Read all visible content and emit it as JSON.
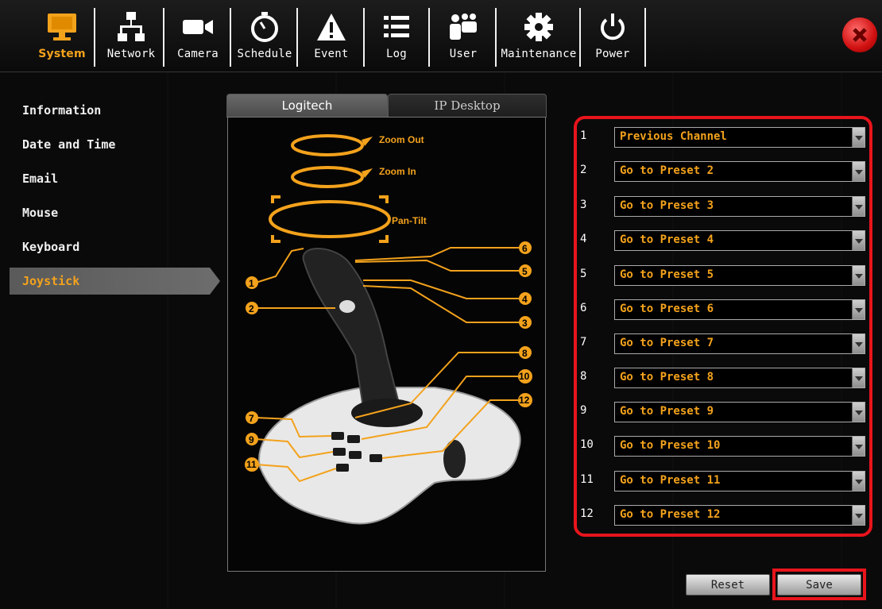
{
  "toolbar": {
    "items": [
      {
        "label": "System",
        "icon": "monitor-icon",
        "active": true
      },
      {
        "label": "Network",
        "icon": "network-icon"
      },
      {
        "label": "Camera",
        "icon": "camera-icon"
      },
      {
        "label": "Schedule",
        "icon": "stopwatch-icon"
      },
      {
        "label": "Event",
        "icon": "warning-icon"
      },
      {
        "label": "Log",
        "icon": "list-icon"
      },
      {
        "label": "User",
        "icon": "users-icon"
      },
      {
        "label": "Maintenance",
        "icon": "gear-icon"
      },
      {
        "label": "Power",
        "icon": "power-icon"
      }
    ],
    "close_icon": "close-icon"
  },
  "sidebar": {
    "items": [
      {
        "label": "Information"
      },
      {
        "label": "Date and Time"
      },
      {
        "label": "Email"
      },
      {
        "label": "Mouse"
      },
      {
        "label": "Keyboard"
      },
      {
        "label": "Joystick",
        "active": true
      }
    ]
  },
  "tabs": [
    {
      "label": "Logitech",
      "active": true
    },
    {
      "label": "IP Desktop"
    }
  ],
  "joystick": {
    "zoom_out": "Zoom Out",
    "zoom_in": "Zoom In",
    "pan_tilt": "Pan-Tilt",
    "button_numbers": [
      "1",
      "2",
      "3",
      "4",
      "5",
      "6",
      "7",
      "8",
      "9",
      "10",
      "11",
      "12"
    ]
  },
  "mappings": [
    {
      "number": "1",
      "action": "Previous Channel"
    },
    {
      "number": "2",
      "action": "Go to Preset 2"
    },
    {
      "number": "3",
      "action": "Go to Preset 3"
    },
    {
      "number": "4",
      "action": "Go to Preset 4"
    },
    {
      "number": "5",
      "action": "Go to Preset 5"
    },
    {
      "number": "6",
      "action": "Go to Preset 6"
    },
    {
      "number": "7",
      "action": "Go to Preset 7"
    },
    {
      "number": "8",
      "action": "Go to Preset 8"
    },
    {
      "number": "9",
      "action": "Go to Preset 9"
    },
    {
      "number": "10",
      "action": "Go to Preset 10"
    },
    {
      "number": "11",
      "action": "Go to Preset 11"
    },
    {
      "number": "12",
      "action": "Go to Preset 12"
    }
  ],
  "buttons": {
    "reset": "Reset",
    "save": "Save"
  },
  "colors": {
    "accent": "#f3a21c",
    "highlight": "#e8141c"
  }
}
